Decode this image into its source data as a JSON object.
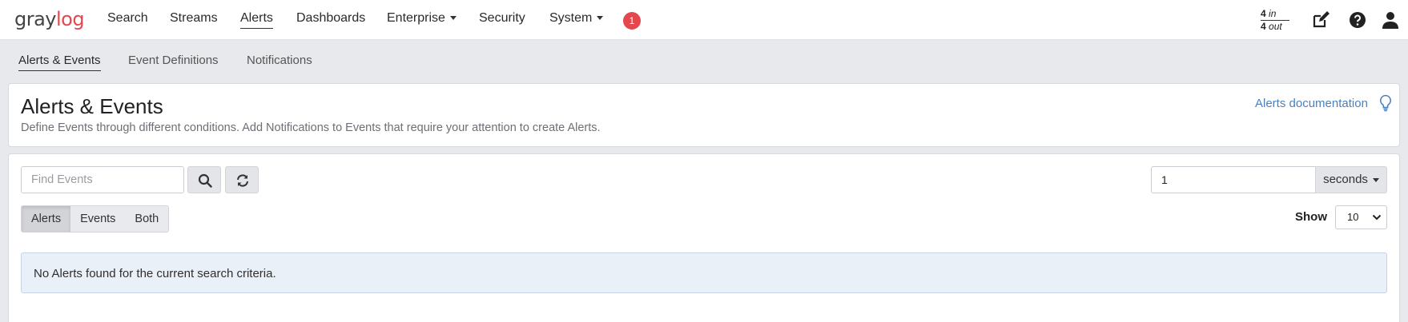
{
  "app": {
    "logo_gray": "gray",
    "logo_accent": "log"
  },
  "navbar": {
    "items": [
      {
        "label": "Search"
      },
      {
        "label": "Streams"
      },
      {
        "label": "Alerts"
      },
      {
        "label": "Dashboards"
      },
      {
        "label": "Enterprise"
      },
      {
        "label": "Security"
      },
      {
        "label": "System"
      }
    ],
    "active": "Alerts",
    "notification_count": "1",
    "throughput": {
      "in_value": "4",
      "in_label": "in",
      "out_value": "4",
      "out_label": "out"
    },
    "icons": [
      "edit-icon",
      "help-icon",
      "user-icon"
    ]
  },
  "subnav": {
    "items": [
      {
        "label": "Alerts & Events"
      },
      {
        "label": "Event Definitions"
      },
      {
        "label": "Notifications"
      }
    ],
    "active": "Alerts & Events"
  },
  "header": {
    "title": "Alerts & Events",
    "description": "Define Events through different conditions. Add Notifications to Events that require your attention to create Alerts.",
    "doc_link": "Alerts documentation"
  },
  "controls": {
    "search_placeholder": "Find Events",
    "refresh_interval": "1",
    "refresh_unit": "seconds",
    "filter_buttons": [
      {
        "label": "Alerts"
      },
      {
        "label": "Events"
      },
      {
        "label": "Both"
      }
    ],
    "filter_active": "Alerts",
    "show_label": "Show",
    "page_size": "10"
  },
  "results": {
    "empty_message": "No Alerts found for the current search criteria."
  },
  "colors": {
    "accent_red": "#e5474e",
    "link_blue": "#4a7fc1",
    "info_bg": "#eaf0f7"
  }
}
